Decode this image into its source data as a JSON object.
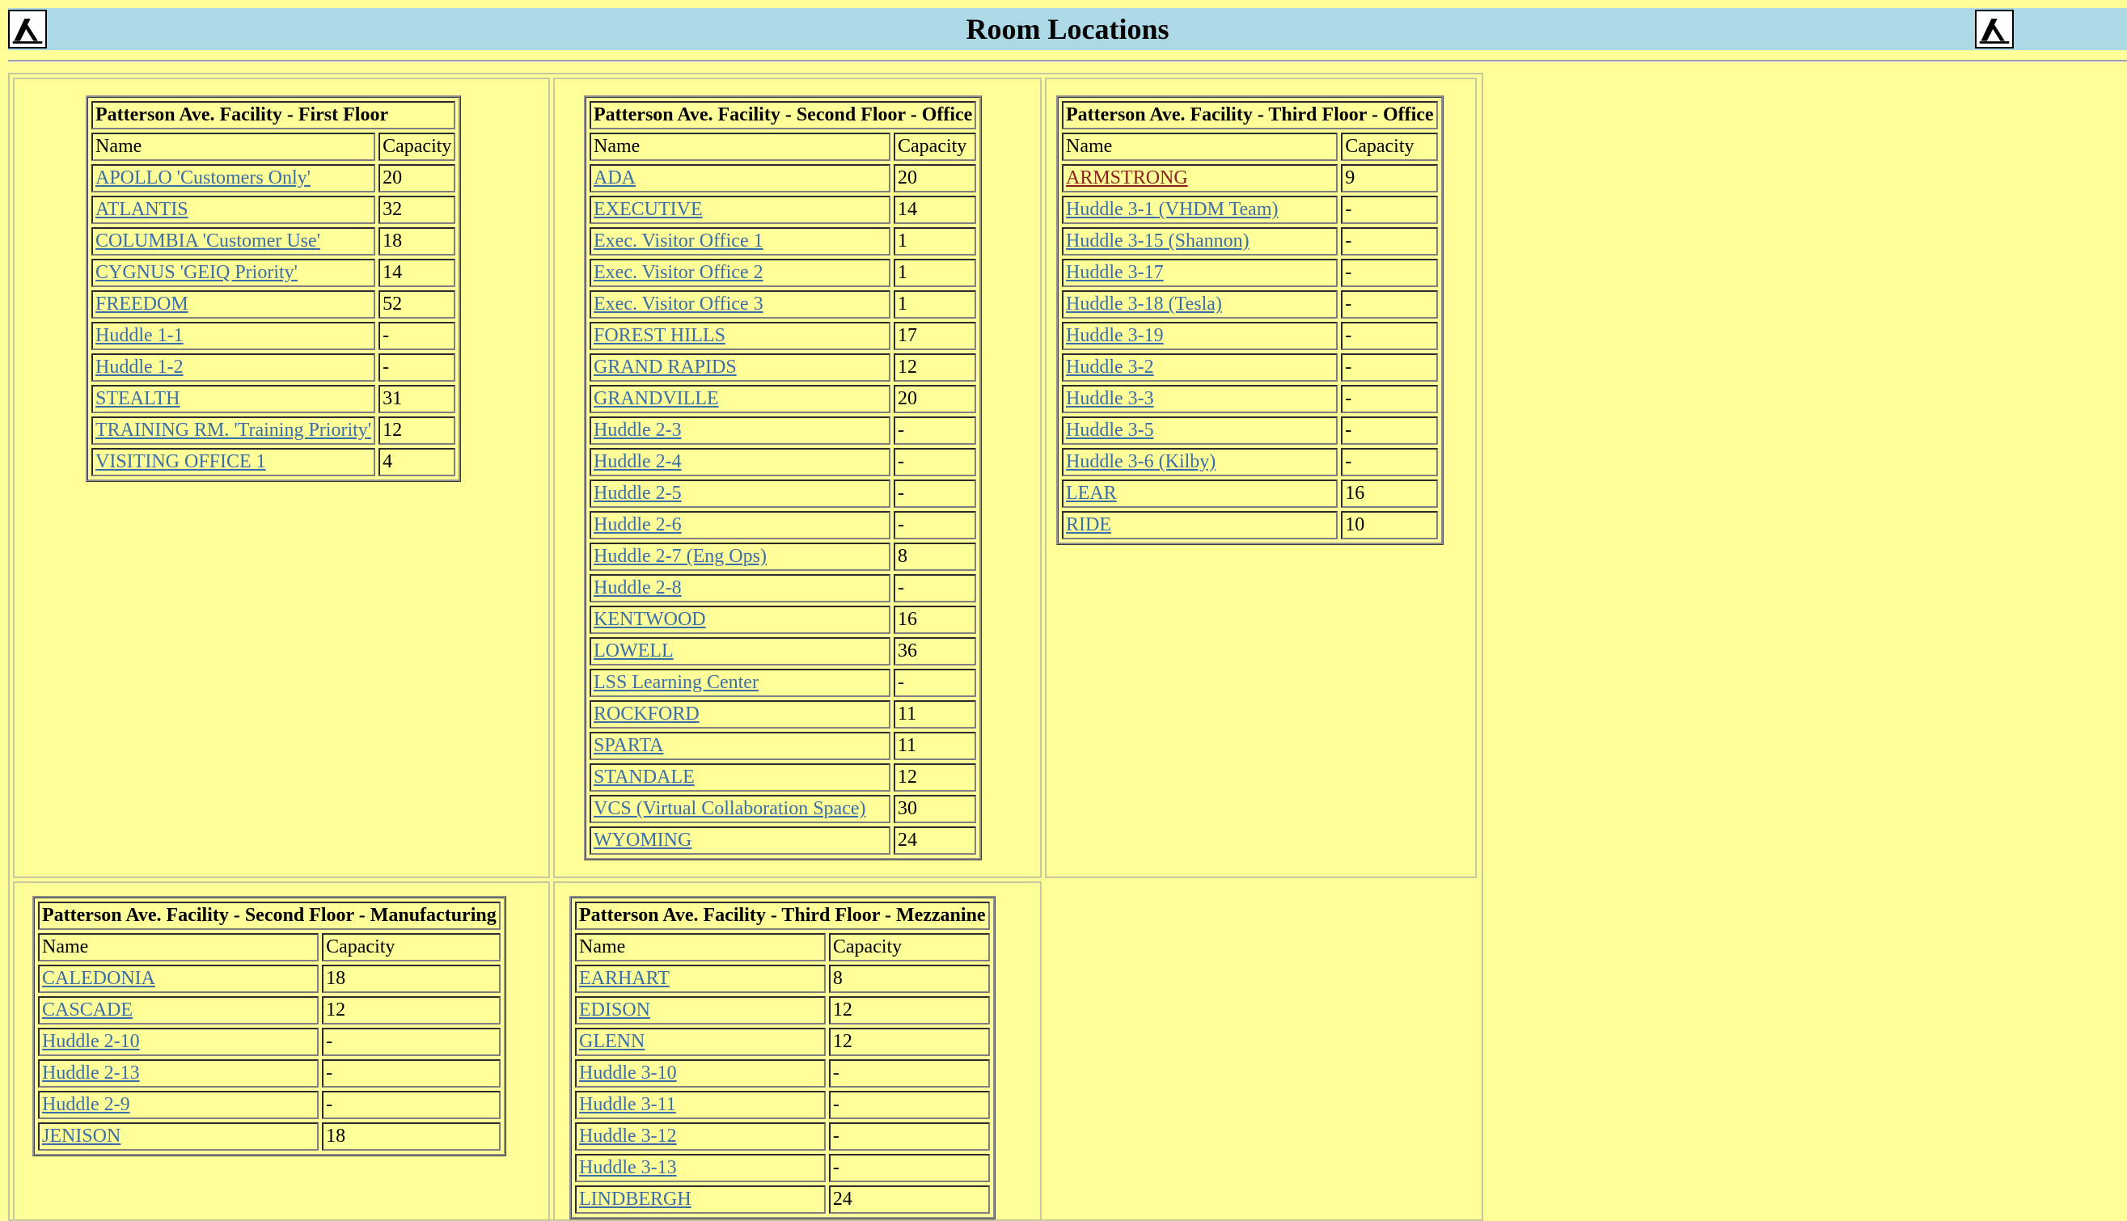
{
  "header": {
    "title": "Room Locations",
    "left_icon": "yellow-pages-walking-fingers-icon",
    "right_icon": "yellow-pages-walking-fingers-icon"
  },
  "colors": {
    "page_bg": "#ffff99",
    "header_bg": "#add8e6",
    "link": "#3b6ea8",
    "visited_link": "#8b2020"
  },
  "tables": [
    {
      "title": "Patterson Ave. Facility - First Floor",
      "col_name": "Name",
      "col_capacity": "Capacity",
      "rows": [
        {
          "name": "APOLLO 'Customers Only'",
          "capacity": "20"
        },
        {
          "name": "ATLANTIS",
          "capacity": "32"
        },
        {
          "name": "COLUMBIA 'Customer Use'",
          "capacity": "18"
        },
        {
          "name": "CYGNUS 'GEIQ Priority'",
          "capacity": "14"
        },
        {
          "name": "FREEDOM",
          "capacity": "52"
        },
        {
          "name": "Huddle 1-1",
          "capacity": "-"
        },
        {
          "name": "Huddle 1-2",
          "capacity": "-"
        },
        {
          "name": "STEALTH",
          "capacity": "31"
        },
        {
          "name": "TRAINING RM. 'Training Priority'",
          "capacity": "12"
        },
        {
          "name": "VISITING OFFICE 1",
          "capacity": "4"
        }
      ]
    },
    {
      "title": "Patterson Ave. Facility - Second Floor - Office",
      "col_name": "Name",
      "col_capacity": "Capacity",
      "rows": [
        {
          "name": "ADA",
          "capacity": "20"
        },
        {
          "name": "EXECUTIVE",
          "capacity": "14"
        },
        {
          "name": "Exec. Visitor Office 1",
          "capacity": "1"
        },
        {
          "name": "Exec. Visitor Office 2",
          "capacity": "1"
        },
        {
          "name": "Exec. Visitor Office 3",
          "capacity": "1"
        },
        {
          "name": "FOREST HILLS",
          "capacity": "17"
        },
        {
          "name": "GRAND RAPIDS",
          "capacity": "12"
        },
        {
          "name": "GRANDVILLE",
          "capacity": "20"
        },
        {
          "name": "Huddle 2-3",
          "capacity": "-"
        },
        {
          "name": "Huddle 2-4",
          "capacity": "-"
        },
        {
          "name": "Huddle 2-5",
          "capacity": "-"
        },
        {
          "name": "Huddle 2-6",
          "capacity": "-"
        },
        {
          "name": "Huddle 2-7 (Eng Ops)",
          "capacity": "8"
        },
        {
          "name": "Huddle 2-8",
          "capacity": "-"
        },
        {
          "name": "KENTWOOD",
          "capacity": "16"
        },
        {
          "name": "LOWELL",
          "capacity": "36"
        },
        {
          "name": "LSS Learning Center",
          "capacity": "-"
        },
        {
          "name": "ROCKFORD",
          "capacity": "11"
        },
        {
          "name": "SPARTA",
          "capacity": "11"
        },
        {
          "name": "STANDALE",
          "capacity": "12"
        },
        {
          "name": "VCS (Virtual Collaboration Space)",
          "capacity": "30"
        },
        {
          "name": "WYOMING",
          "capacity": "24"
        }
      ]
    },
    {
      "title": "Patterson Ave. Facility - Third Floor - Office",
      "col_name": "Name",
      "col_capacity": "Capacity",
      "rows": [
        {
          "name": "ARMSTRONG",
          "capacity": "9",
          "visited": true
        },
        {
          "name": "Huddle 3-1 (VHDM Team)",
          "capacity": "-"
        },
        {
          "name": "Huddle 3-15 (Shannon)",
          "capacity": "-"
        },
        {
          "name": "Huddle 3-17",
          "capacity": "-"
        },
        {
          "name": "Huddle 3-18 (Tesla)",
          "capacity": "-"
        },
        {
          "name": "Huddle 3-19",
          "capacity": "-"
        },
        {
          "name": "Huddle 3-2",
          "capacity": "-"
        },
        {
          "name": "Huddle 3-3",
          "capacity": "-"
        },
        {
          "name": "Huddle 3-5",
          "capacity": "-"
        },
        {
          "name": "Huddle 3-6 (Kilby)",
          "capacity": "-"
        },
        {
          "name": "LEAR",
          "capacity": "16"
        },
        {
          "name": "RIDE",
          "capacity": "10"
        }
      ]
    },
    {
      "title": "Patterson Ave. Facility - Second Floor - Manufacturing",
      "col_name": "Name",
      "col_capacity": "Capacity",
      "rows": [
        {
          "name": "CALEDONIA",
          "capacity": "18"
        },
        {
          "name": "CASCADE",
          "capacity": "12"
        },
        {
          "name": "Huddle 2-10",
          "capacity": "-"
        },
        {
          "name": "Huddle 2-13",
          "capacity": "-"
        },
        {
          "name": "Huddle 2-9",
          "capacity": "-"
        },
        {
          "name": "JENISON",
          "capacity": "18"
        }
      ]
    },
    {
      "title": "Patterson Ave. Facility - Third Floor - Mezzanine",
      "col_name": "Name",
      "col_capacity": "Capacity",
      "rows": [
        {
          "name": "EARHART",
          "capacity": "8"
        },
        {
          "name": "EDISON",
          "capacity": "12"
        },
        {
          "name": "GLENN",
          "capacity": "12"
        },
        {
          "name": "Huddle 3-10",
          "capacity": "-"
        },
        {
          "name": "Huddle 3-11",
          "capacity": "-"
        },
        {
          "name": "Huddle 3-12",
          "capacity": "-"
        },
        {
          "name": "Huddle 3-13",
          "capacity": "-"
        },
        {
          "name": "LINDBERGH",
          "capacity": "24"
        }
      ]
    }
  ]
}
